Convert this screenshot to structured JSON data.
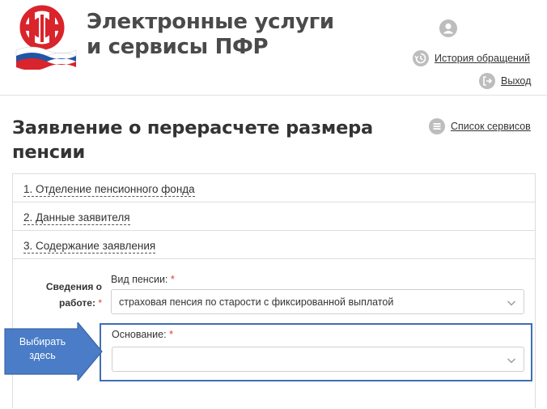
{
  "header": {
    "title_line1": "Электронные услуги",
    "title_line2": "и сервисы ПФР",
    "logo_text": "ПФР",
    "history_label": "История обращений",
    "logout_label": "Выход"
  },
  "page": {
    "title_line1": "Заявление о перерасчете размера",
    "title_line2": "пенсии",
    "services_label": "Список сервисов"
  },
  "accordion": {
    "items": [
      {
        "label": "1. Отделение пенсионного фонда"
      },
      {
        "label": "2. Данные заявителя"
      },
      {
        "label": "3. Содержание заявления"
      }
    ]
  },
  "form": {
    "section_label_line1": "Сведения о",
    "section_label_line2": "работе:",
    "required_mark": "*",
    "pension_type_label": "Вид пенсии:",
    "pension_type_value": "страховая пенсия по старости с фиксированной выплатой",
    "reason_label": "Основание:",
    "reason_value": ""
  },
  "callout": {
    "text_line1": "Выбирать",
    "text_line2": "здесь"
  },
  "colors": {
    "accent_blue": "#3f6fb5",
    "callout_fill": "#4a7cc7",
    "required_red": "#e53935",
    "logo_red": "#d9242b",
    "icon_grey": "#bdbdbd"
  },
  "icons": {
    "avatar": "user-avatar-icon",
    "history": "history-icon",
    "logout": "logout-icon",
    "services": "list-icon",
    "dropdown": "chevron-down-icon"
  }
}
